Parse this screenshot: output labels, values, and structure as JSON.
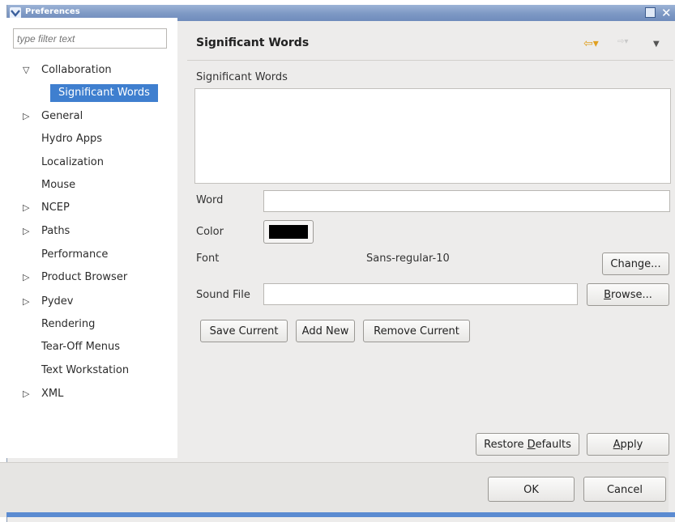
{
  "window": {
    "title": "Preferences"
  },
  "filter": {
    "placeholder": "type filter text"
  },
  "tree": {
    "collaboration": "Collaboration",
    "significant_words": "Significant Words",
    "general": "General",
    "hydro_apps": "Hydro Apps",
    "localization": "Localization",
    "mouse": "Mouse",
    "ncep": "NCEP",
    "paths": "Paths",
    "performance": "Performance",
    "product_browser": "Product Browser",
    "pydev": "Pydev",
    "rendering": "Rendering",
    "tear_off_menus": "Tear-Off Menus",
    "text_workstation": "Text Workstation",
    "xml": "XML"
  },
  "page": {
    "title": "Significant Words",
    "list_label": "Significant Words",
    "word_label": "Word",
    "word_value": "",
    "color_label": "Color",
    "color_value": "#000000",
    "font_label": "Font",
    "font_value": "Sans-regular-10",
    "change_button": "Change...",
    "sound_label": "Sound File",
    "sound_value": "",
    "browse_button": "Browse...",
    "save_current": "Save Current",
    "add_new": "Add New",
    "remove_current": "Remove Current",
    "restore_defaults": "Restore Defaults",
    "apply": "Apply"
  },
  "dialog": {
    "ok": "OK",
    "cancel": "Cancel"
  },
  "colors": {
    "selection": "#3f7fcf",
    "titlebar": "#7d98c4"
  },
  "icons": {
    "back": "back-arrow-icon",
    "forward": "forward-arrow-icon",
    "menu": "view-menu-icon"
  }
}
